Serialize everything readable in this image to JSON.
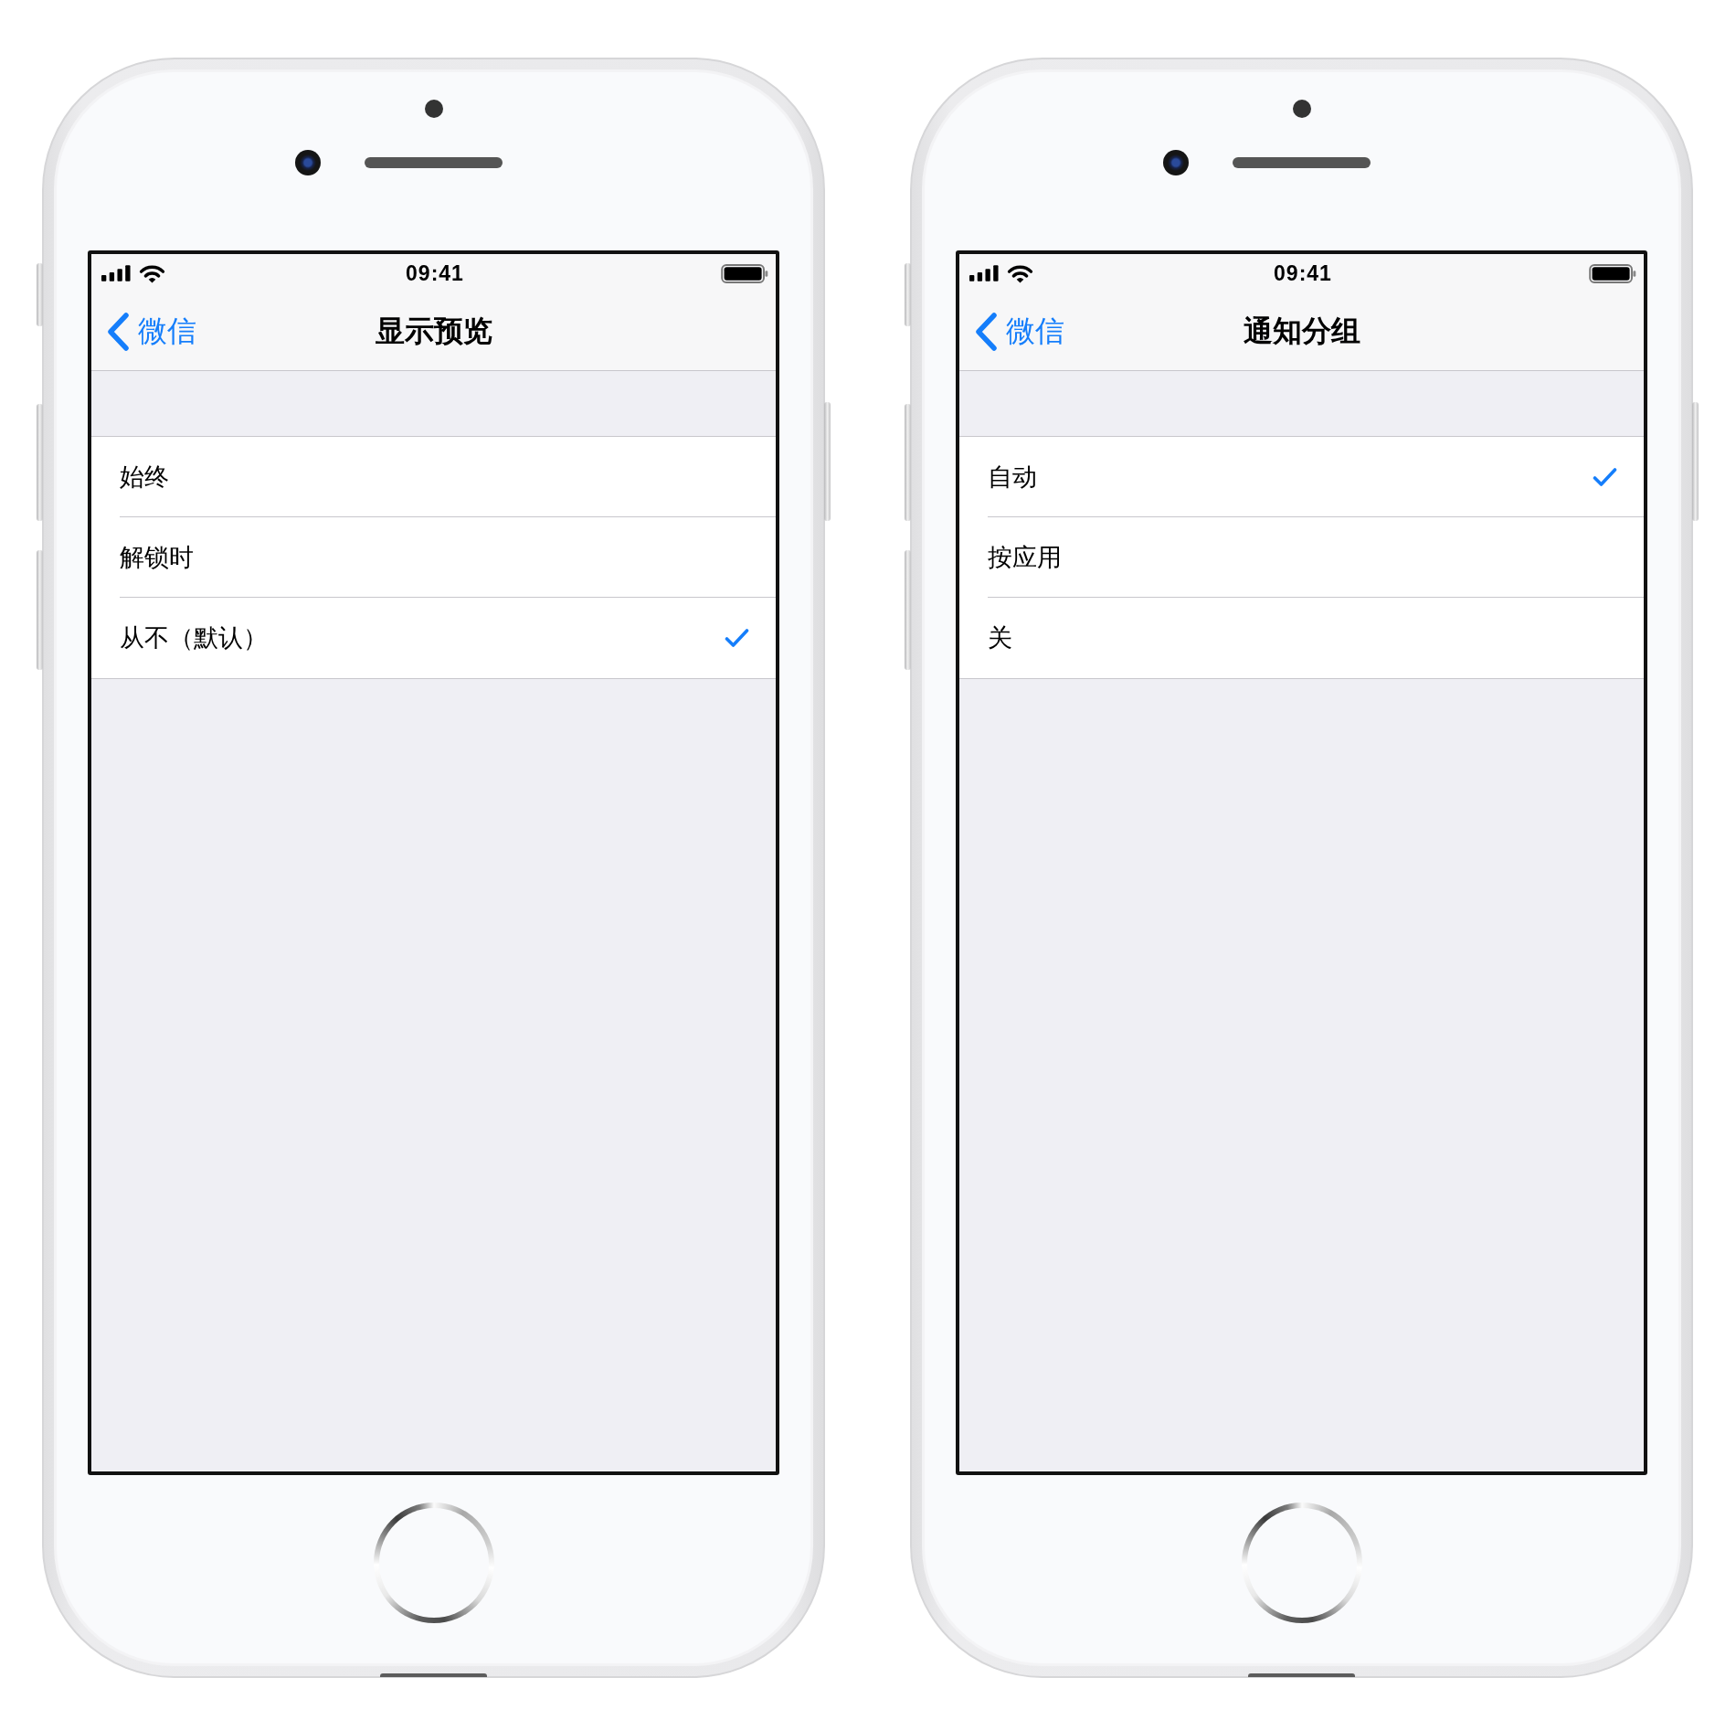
{
  "phones": [
    {
      "status_bar": {
        "time": "09:41"
      },
      "nav_bar": {
        "back": "微信",
        "title": "显示预览"
      },
      "options": [
        {
          "label": "始终",
          "selected": false
        },
        {
          "label": "解锁时",
          "selected": false
        },
        {
          "label": "从不（默认）",
          "selected": true
        }
      ]
    },
    {
      "status_bar": {
        "time": "09:41"
      },
      "nav_bar": {
        "back": "微信",
        "title": "通知分组"
      },
      "options": [
        {
          "label": "自动",
          "selected": true
        },
        {
          "label": "按应用",
          "selected": false
        },
        {
          "label": "关",
          "selected": false
        }
      ]
    }
  ]
}
